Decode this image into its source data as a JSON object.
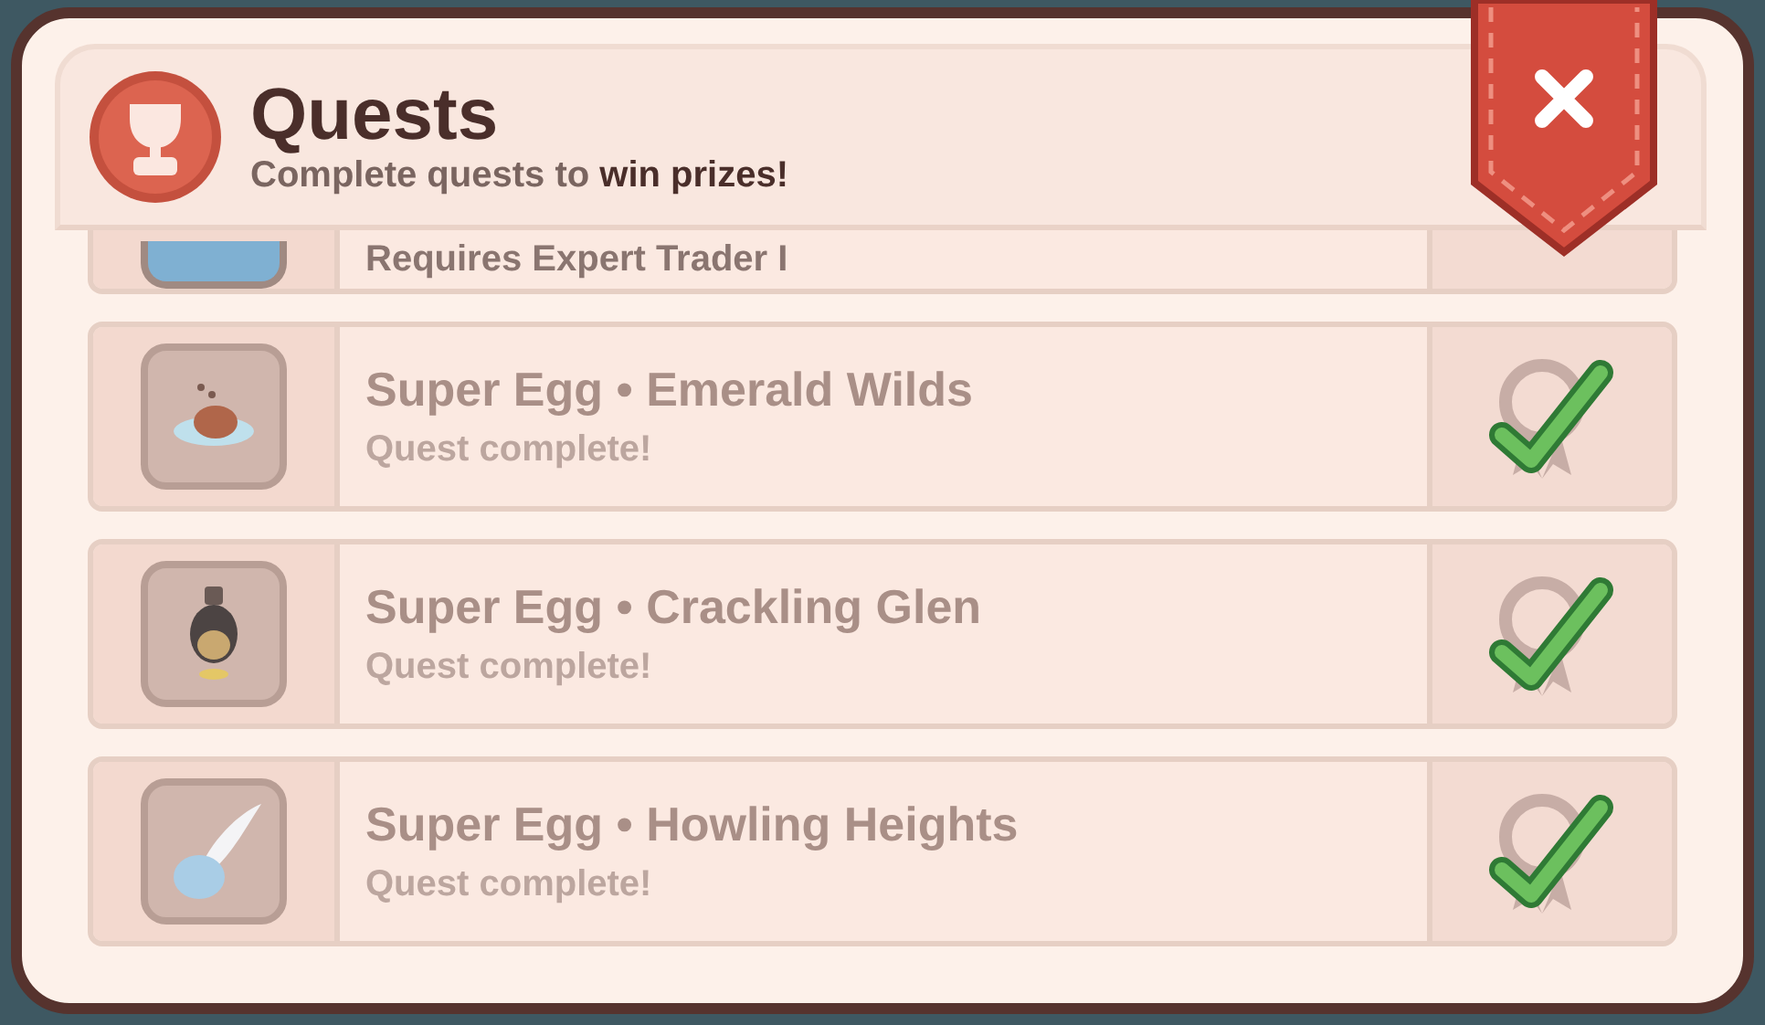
{
  "header": {
    "title": "Quests",
    "subtitle": "Complete quests to **win prizes!**"
  },
  "rows": [
    {
      "kind": "partial",
      "subtitle": "Requires Expert Trader I",
      "completed": false
    },
    {
      "kind": "egg",
      "title": "Super Egg • Emerald Wilds",
      "subtitle": "Quest complete!",
      "completed": true
    },
    {
      "kind": "potion",
      "title": "Super Egg • Crackling Glen",
      "subtitle": "Quest complete!",
      "completed": true
    },
    {
      "kind": "winged",
      "title": "Super Egg • Howling Heights",
      "subtitle": "Quest complete!",
      "completed": true
    }
  ]
}
